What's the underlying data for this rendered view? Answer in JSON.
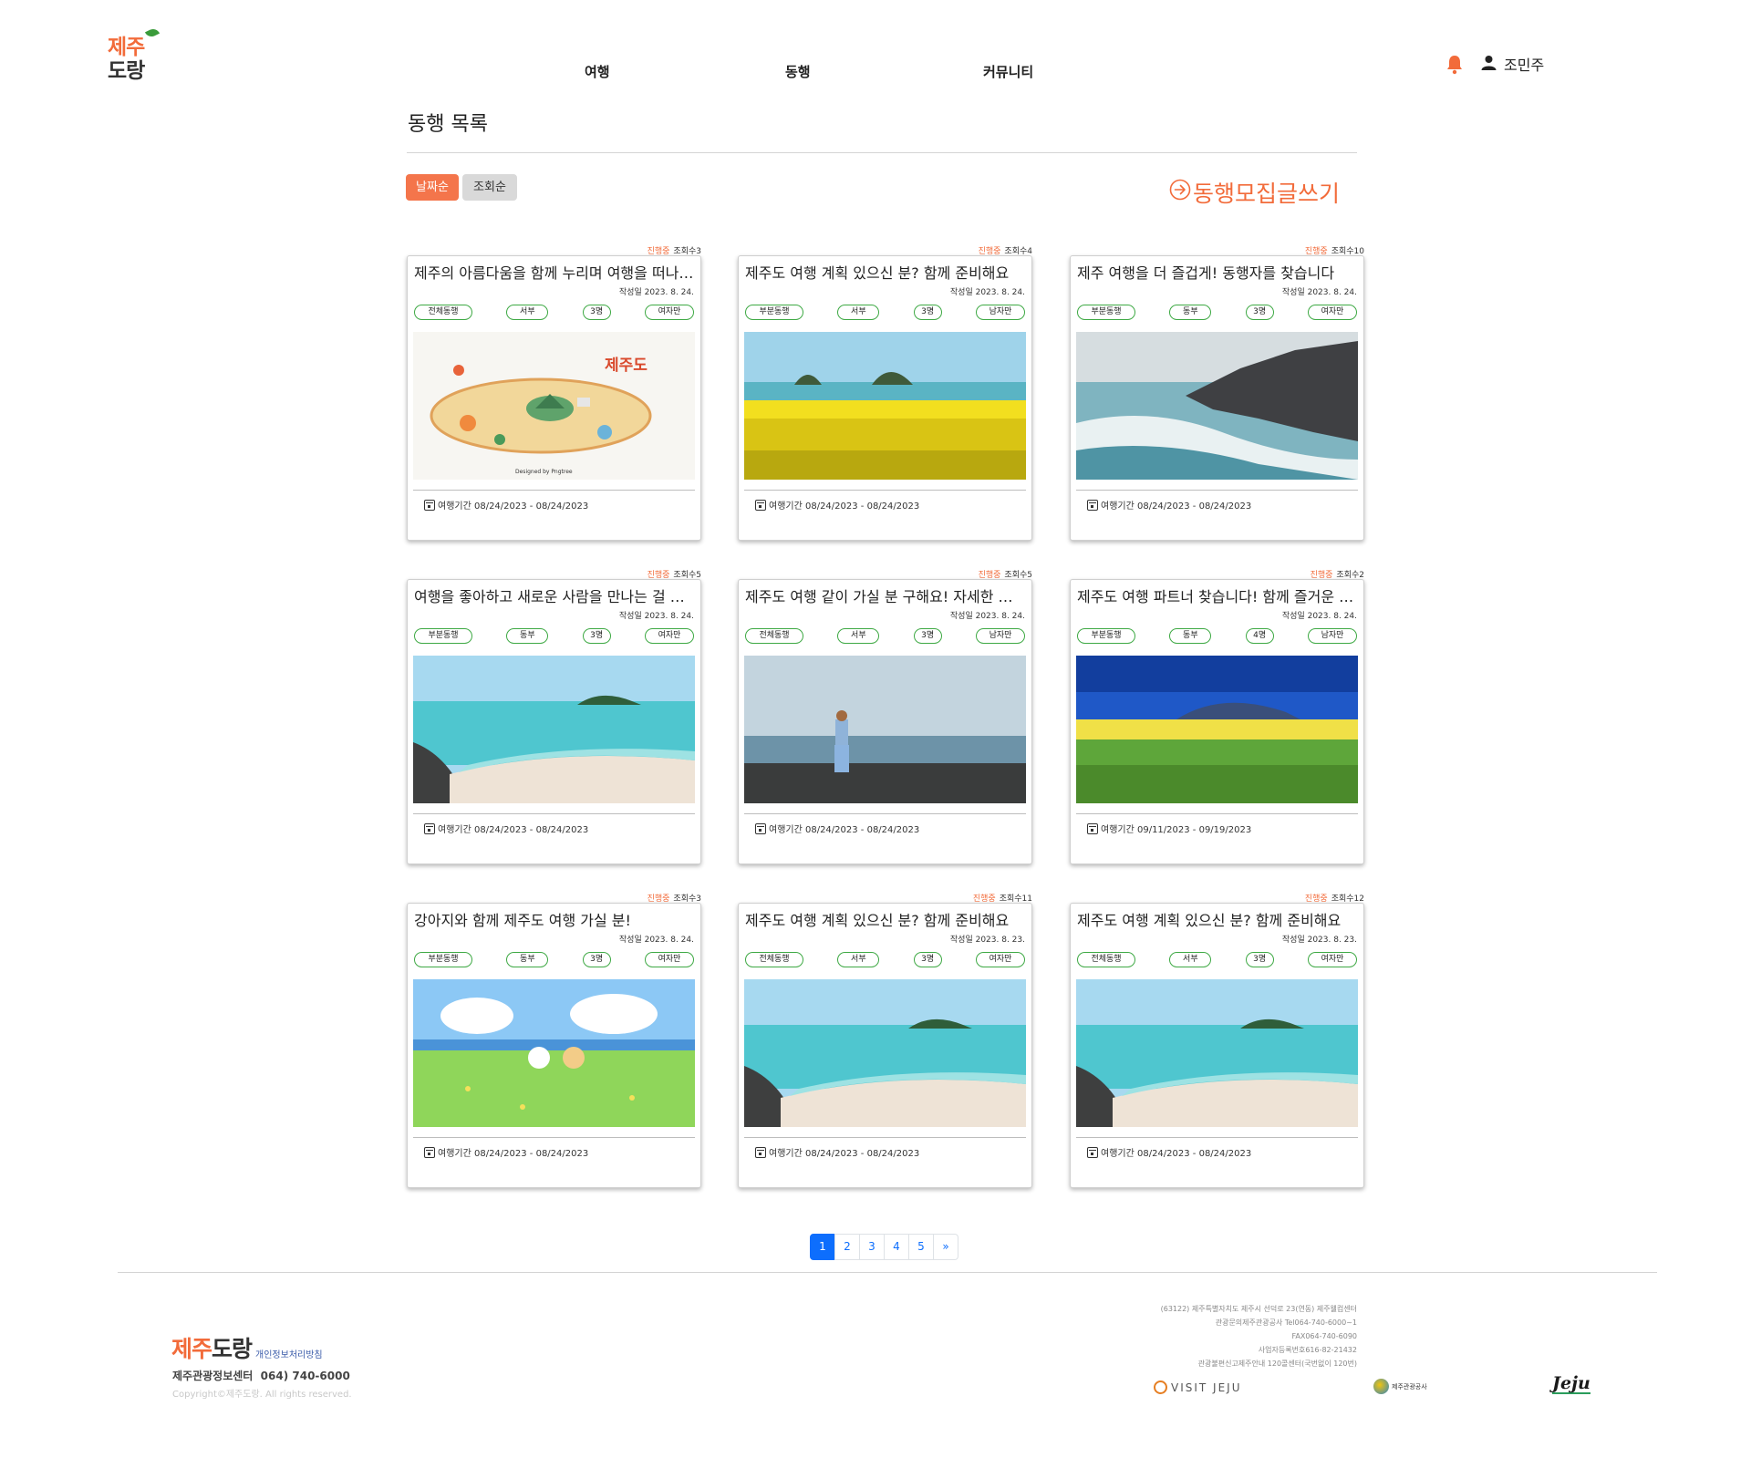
{
  "brand": {
    "line1": "제주",
    "line2": "도랑"
  },
  "nav": {
    "items": [
      {
        "label": "여행"
      },
      {
        "label": "동행"
      },
      {
        "label": "커뮤니티"
      }
    ]
  },
  "user": {
    "name": "조민주"
  },
  "page": {
    "title": "동행 목록"
  },
  "sort": {
    "date_label": "날짜순",
    "views_label": "조회순"
  },
  "write_label": "동행모집글쓰기",
  "posts": [
    {
      "status": "진행중",
      "views": "조회수3",
      "title": "제주의 아름다움을 함께 누리며 여행을 떠나요!",
      "date": "작성일 2023. 8. 24.",
      "tags": [
        "전체동행",
        "서부",
        "3명",
        "여자만"
      ],
      "image": "map-illustration",
      "period": "여행기간 08/24/2023 - 08/24/2023"
    },
    {
      "status": "진행중",
      "views": "조회수4",
      "title": "제주도 여행 계획 있으신 분? 함께 준비해요",
      "date": "작성일 2023. 8. 24.",
      "tags": [
        "부분동행",
        "서부",
        "3명",
        "남자만"
      ],
      "image": "canola-flowers-sea",
      "period": "여행기간 08/24/2023 - 08/24/2023"
    },
    {
      "status": "진행중",
      "views": "조회수10",
      "title": "제주 여행을 더 즐겁게! 동행자를 찾습니다",
      "date": "작성일 2023. 8. 24.",
      "tags": [
        "부분동행",
        "동부",
        "3명",
        "여자만"
      ],
      "image": "rocky-coast",
      "period": "여행기간 08/24/2023 - 08/24/2023"
    },
    {
      "status": "진행중",
      "views": "조회수5",
      "title": "여행을 좋아하고 새로운 사람을 만나는 걸 좋아해요",
      "date": "작성일 2023. 8. 24.",
      "tags": [
        "부분동행",
        "동부",
        "3명",
        "여자만"
      ],
      "image": "beach-island",
      "period": "여행기간 08/24/2023 - 08/24/2023"
    },
    {
      "status": "진행중",
      "views": "조회수5",
      "title": "제주도 여행 같이 가실 분 구해요! 자세한 내용은",
      "date": "작성일 2023. 8. 24.",
      "tags": [
        "전체동행",
        "서부",
        "3명",
        "남자만"
      ],
      "image": "person-on-rocks",
      "period": "여행기간 08/24/2023 - 08/24/2023"
    },
    {
      "status": "진행중",
      "views": "조회수2",
      "title": "제주도 여행 파트너 찾습니다! 함께 즐거운 추억을",
      "date": "작성일 2023. 8. 24.",
      "tags": [
        "부분동행",
        "동부",
        "4명",
        "남자만"
      ],
      "image": "canola-mountain",
      "period": "여행기간 09/11/2023 - 09/19/2023"
    },
    {
      "status": "진행중",
      "views": "조회수3",
      "title": "강아지와 함께 제주도 여행 가실 분!",
      "date": "작성일 2023. 8. 24.",
      "tags": [
        "부분동행",
        "동부",
        "3명",
        "여자만"
      ],
      "image": "cartoon-picnic",
      "period": "여행기간 08/24/2023 - 08/24/2023"
    },
    {
      "status": "진행중",
      "views": "조회수11",
      "title": "제주도 여행 계획 있으신 분? 함께 준비해요",
      "date": "작성일 2023. 8. 23.",
      "tags": [
        "전체동행",
        "서부",
        "3명",
        "여자만"
      ],
      "image": "beach-island",
      "period": "여행기간 08/24/2023 - 08/24/2023"
    },
    {
      "status": "진행중",
      "views": "조회수12",
      "title": "제주도 여행 계획 있으신 분? 함께 준비해요",
      "date": "작성일 2023. 8. 23.",
      "tags": [
        "전체동행",
        "서부",
        "3명",
        "여자만"
      ],
      "image": "beach-island",
      "period": "여행기간 08/24/2023 - 08/24/2023"
    }
  ],
  "pagination": {
    "pages": [
      "1",
      "2",
      "3",
      "4",
      "5"
    ],
    "next": "»",
    "current": "1"
  },
  "footer": {
    "logo_a": "제주",
    "logo_b": "도랑",
    "privacy": "개인정보처리방침",
    "center": "제주관광정보센터  064) 740-6000",
    "copyright": "Copyright©제주도랑. All rights reserved.",
    "address": [
      "(63122) 제주특별자치도 제주시 선덕로 23(연동) 제주웰컴센터",
      "관광문의제주관광공사 Tel064-740-6000~1",
      "FAX064-740-6090",
      "사업자등록번호616-82-21432",
      "관광불편신고제주안내 120콜센터(국번없이 120번)"
    ],
    "visit_label": "VISIT JEJU",
    "corp_label": "제주관광공사",
    "jeju_label": "Jeju"
  },
  "colors": {
    "accent": "#f26b3a",
    "tag_border": "#3ea944",
    "page_active": "#0d6efd"
  },
  "icons": {
    "bell": "bell-icon",
    "user": "user-icon",
    "write": "arrow-circle-right-icon",
    "calendar": "calendar-icon"
  }
}
